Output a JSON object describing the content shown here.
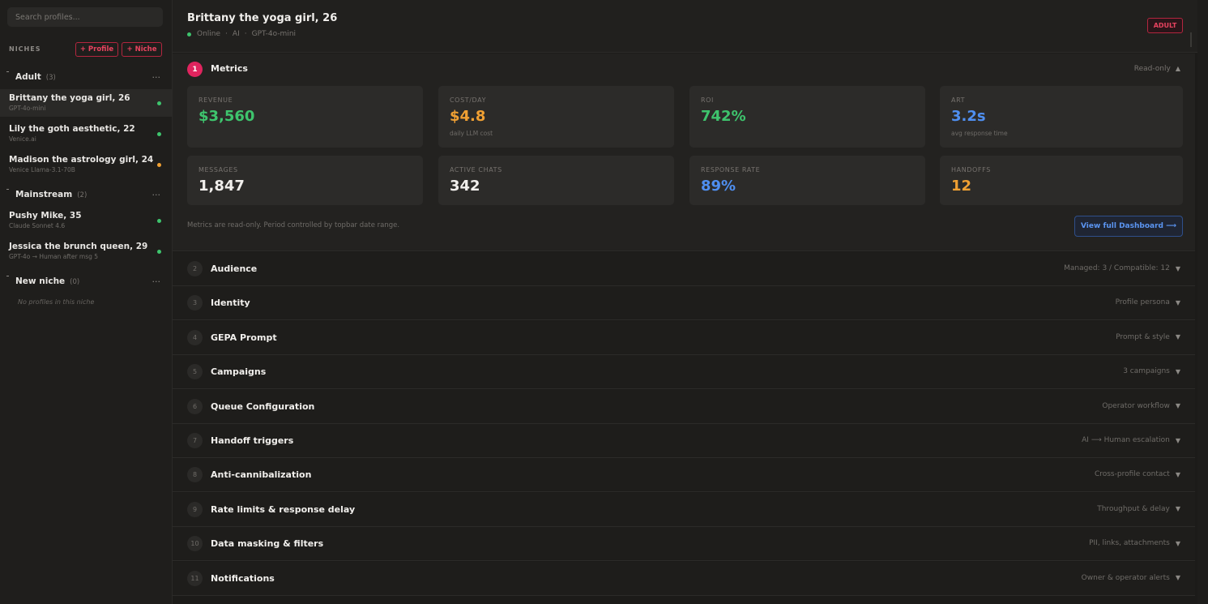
{
  "sidebar": {
    "search_placeholder": "Search profiles...",
    "niches_label": "NICHES",
    "add_profile_label": "+ Profile",
    "add_niche_label": "+ Niche",
    "groups": [
      {
        "name": "Adult",
        "count": "(3)",
        "menu": "···",
        "profiles": [
          {
            "name": "Brittany the yoga girl, 26",
            "model": "GPT-4o-mini",
            "status": "green"
          },
          {
            "name": "Lily the goth aesthetic, 22",
            "model": "Venice.ai",
            "status": "green"
          },
          {
            "name": "Madison the astrology girl, 24",
            "model": "Venice Llama-3.1-70B",
            "status": "orange"
          }
        ]
      },
      {
        "name": "Mainstream",
        "count": "(2)",
        "menu": "···",
        "profiles": [
          {
            "name": "Pushy Mike, 35",
            "model": "Claude Sonnet 4.6",
            "status": "green"
          },
          {
            "name": "Jessica the brunch queen, 29",
            "model": "GPT-4o → Human after msg 5",
            "status": "green"
          }
        ]
      },
      {
        "name": "New niche",
        "count": "(0)",
        "menu": "···",
        "empty_note": "No profiles in this niche",
        "profiles": []
      }
    ]
  },
  "header": {
    "title": "Brittany the yoga girl, 26",
    "status": "Online",
    "type": "AI",
    "model": "GPT-4o-mini",
    "separator": "·",
    "badge": "ADULT"
  },
  "metrics": {
    "number": "1",
    "title": "Metrics",
    "mode": "Read-only",
    "caret": "▲",
    "cards": [
      {
        "label": "REVENUE",
        "value": "$3,560",
        "sub": "",
        "color": "#3ec46d"
      },
      {
        "label": "COST/DAY",
        "value": "$4.8",
        "sub": "daily LLM cost",
        "color": "#f0a033"
      },
      {
        "label": "ROI",
        "value": "742%",
        "sub": "",
        "color": "#3ec46d"
      },
      {
        "label": "ART",
        "value": "3.2s",
        "sub": "avg response time",
        "color": "#4f8ff0"
      },
      {
        "label": "MESSAGES",
        "value": "1,847",
        "sub": "",
        "color": "#f1efec"
      },
      {
        "label": "ACTIVE CHATS",
        "value": "342",
        "sub": "",
        "color": "#f1efec"
      },
      {
        "label": "RESPONSE RATE",
        "value": "89%",
        "sub": "",
        "color": "#4f8ff0"
      },
      {
        "label": "HANDOFFS",
        "value": "12",
        "sub": "",
        "color": "#f0a033"
      }
    ],
    "note": "Metrics are read-only. Period controlled by topbar date range.",
    "dashboard_button": "View full Dashboard ⟶"
  },
  "sections": [
    {
      "number": "2",
      "title": "Audience",
      "hint": "Managed: 3 / Compatible: 12"
    },
    {
      "number": "3",
      "title": "Identity",
      "hint": "Profile persona"
    },
    {
      "number": "4",
      "title": "GEPA Prompt",
      "hint": "Prompt & style"
    },
    {
      "number": "5",
      "title": "Campaigns",
      "hint": "3 campaigns"
    },
    {
      "number": "6",
      "title": "Queue Configuration",
      "hint": "Operator workflow"
    },
    {
      "number": "7",
      "title": "Handoff triggers",
      "hint": "AI ⟶ Human escalation"
    },
    {
      "number": "8",
      "title": "Anti-cannibalization",
      "hint": "Cross-profile contact"
    },
    {
      "number": "9",
      "title": "Rate limits & response delay",
      "hint": "Throughput & delay"
    },
    {
      "number": "10",
      "title": "Data masking & filters",
      "hint": "PII, links, attachments"
    },
    {
      "number": "11",
      "title": "Notifications",
      "hint": "Owner & operator alerts"
    }
  ],
  "caret_down": "▼"
}
